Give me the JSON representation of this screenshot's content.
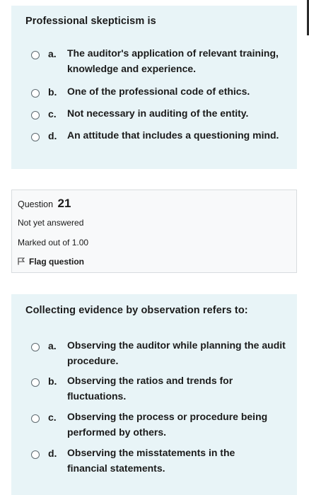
{
  "question1": {
    "text": "Professional skepticism is",
    "options": [
      {
        "letter": "a.",
        "text": "The auditor's application of relevant training, knowledge and experience."
      },
      {
        "letter": "b.",
        "text": "One of the professional code of ethics."
      },
      {
        "letter": "c.",
        "text": "Not necessary in auditing of the entity."
      },
      {
        "letter": "d.",
        "text": "An attitude that includes a questioning mind."
      }
    ]
  },
  "info": {
    "question_label": "Question",
    "question_number": "21",
    "status": "Not yet answered",
    "marks": "Marked out of 1.00",
    "flag_label": "Flag question",
    "flag_icon": "flag-outline-icon"
  },
  "question2": {
    "text": "Collecting evidence by observation refers to:",
    "options": [
      {
        "letter": "a.",
        "text": "Observing the auditor while planning the audit procedure."
      },
      {
        "letter": "b.",
        "text": "Observing the ratios and trends for fluctuations."
      },
      {
        "letter": "c.",
        "text": "Observing the process or procedure being performed by others."
      },
      {
        "letter": "d.",
        "text": "Observing the misstatements in the financial statements."
      }
    ]
  }
}
